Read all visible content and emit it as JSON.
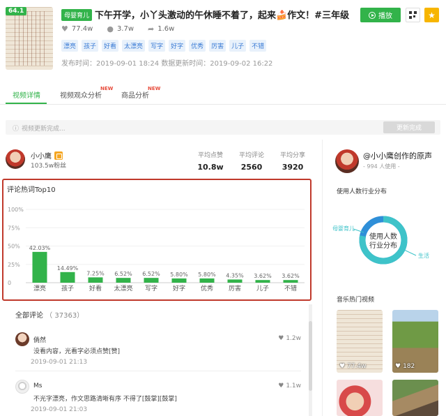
{
  "video": {
    "score": "64.1",
    "category": "母婴育儿",
    "title": "下午开学，小丫头激动的午休睡不着了，起来🍰作文！#三年级",
    "likes": "77.4w",
    "comments": "3.7w",
    "shares": "1.6w",
    "tags": [
      "漂亮",
      "孩子",
      "好看",
      "太漂亮",
      "写字",
      "好字",
      "优秀",
      "厉害",
      "儿子",
      "不错"
    ],
    "publish_time": "发布时间：2019-09-01 18:24",
    "update_time": "数据更新时间：2019-09-02 16:22",
    "play_label": "播放",
    "star_icon": "star-icon",
    "qr_icon": "qr-code-icon"
  },
  "tabs": [
    {
      "label": "视频详情",
      "active": true
    },
    {
      "label": "视频观众分析",
      "badge": "NEW"
    },
    {
      "label": "商品分析",
      "badge": "NEW"
    }
  ],
  "update_bar": {
    "message": "视频更新完成...",
    "button": "更新完成"
  },
  "profile": {
    "name": "小小鹰",
    "fans": "103.5w粉丝",
    "stats": [
      {
        "label": "平均点赞",
        "value": "10.8w"
      },
      {
        "label": "平均评论",
        "value": "2560"
      },
      {
        "label": "平均分享",
        "value": "3920"
      }
    ]
  },
  "chart_data": {
    "type": "bar",
    "title": "评论热词Top10",
    "categories": [
      "漂亮",
      "孩子",
      "好看",
      "太漂亮",
      "写字",
      "好字",
      "优秀",
      "厉害",
      "儿子",
      "不错"
    ],
    "values": [
      42.03,
      14.49,
      7.25,
      6.52,
      6.52,
      5.8,
      5.8,
      4.35,
      3.62,
      3.62
    ],
    "value_labels": [
      "42.03%",
      "14.49%",
      "7.25%",
      "6.52%",
      "6.52%",
      "5.80%",
      "5.80%",
      "4.35%",
      "3.62%",
      "3.62%"
    ],
    "yticks": [
      "0",
      "25%",
      "50%",
      "75%",
      "100%"
    ],
    "ylim": [
      0,
      100
    ],
    "color": "#32b34a",
    "grid": true
  },
  "comments": {
    "label": "全部评论",
    "count": "（ 37363）",
    "items": [
      {
        "name": "倘然",
        "likes": "1.2w",
        "text": "没看内容，光看字必须点赞[赞]",
        "time": "2019-09-01 21:13"
      },
      {
        "name": "Ms",
        "likes": "1.1w",
        "text": "不光字漂亮，作文思路清晰有序 不得了[鼓掌][鼓掌]",
        "time": "2019-09-01 21:03"
      }
    ]
  },
  "music": {
    "title": "@小小鹰创作的原声",
    "users": "- 994 人使用 -",
    "industry_title": "使用人数行业分布",
    "donut_center": [
      "使用人数",
      "行业分布"
    ],
    "donut_labels": [
      "母婴育儿",
      "生活"
    ],
    "donut_colors": [
      "#3ec3c9",
      "#2f8fd8"
    ],
    "hot_title": "音乐热门视频",
    "videos": [
      {
        "count": "77.4w"
      },
      {
        "count": "182"
      }
    ]
  },
  "colors": {
    "accent": "#32b34a",
    "tag_blue": "#3a7bd5",
    "highlight_border": "#c0392b"
  }
}
